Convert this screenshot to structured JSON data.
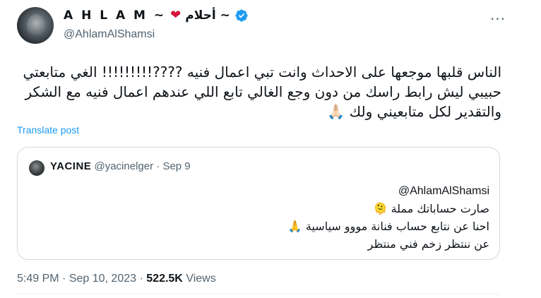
{
  "author": {
    "name_latin": "A H L A M ~",
    "name_arabic": "أحلام ~",
    "handle": "@AhlamAlShamsi",
    "verified": true,
    "icons": [
      "heart-icon",
      "verified-badge-icon"
    ]
  },
  "more_label": "···",
  "post": {
    "lines": [
      "الناس قلبها موجعها على الاحداث وانت تبي اعمال فنيه ????!!!!!!!!! الغي متابعتي",
      "حبيبي ليش رابط راسك من دون وجع الغالي تابع اللي عندهم اعمال فنيه مع الشكر",
      "والتقدير لكل متابعيني ولك 🙏🏻"
    ],
    "translate_label": "Translate post"
  },
  "quote": {
    "name": "YACINE",
    "handle": "@yacinelger",
    "separator": "·",
    "date": "Sep 9",
    "lines": [
      "@AhlamAlShamsi",
      "صارت حساباتك مملة 🫠",
      "احنا عن نتابع حساب فنانة مووو سياسية 🙏",
      "عن ننتظر زخم فني منتظر"
    ]
  },
  "meta": {
    "time": "5:49 PM",
    "separator": "·",
    "date": "Sep 10, 2023",
    "views_count": "522.5K",
    "views_label": "Views"
  },
  "colors": {
    "accent": "#1d9bf0",
    "heart": "#d3163a",
    "secondary_text": "#536471",
    "border": "#cfd9de"
  }
}
